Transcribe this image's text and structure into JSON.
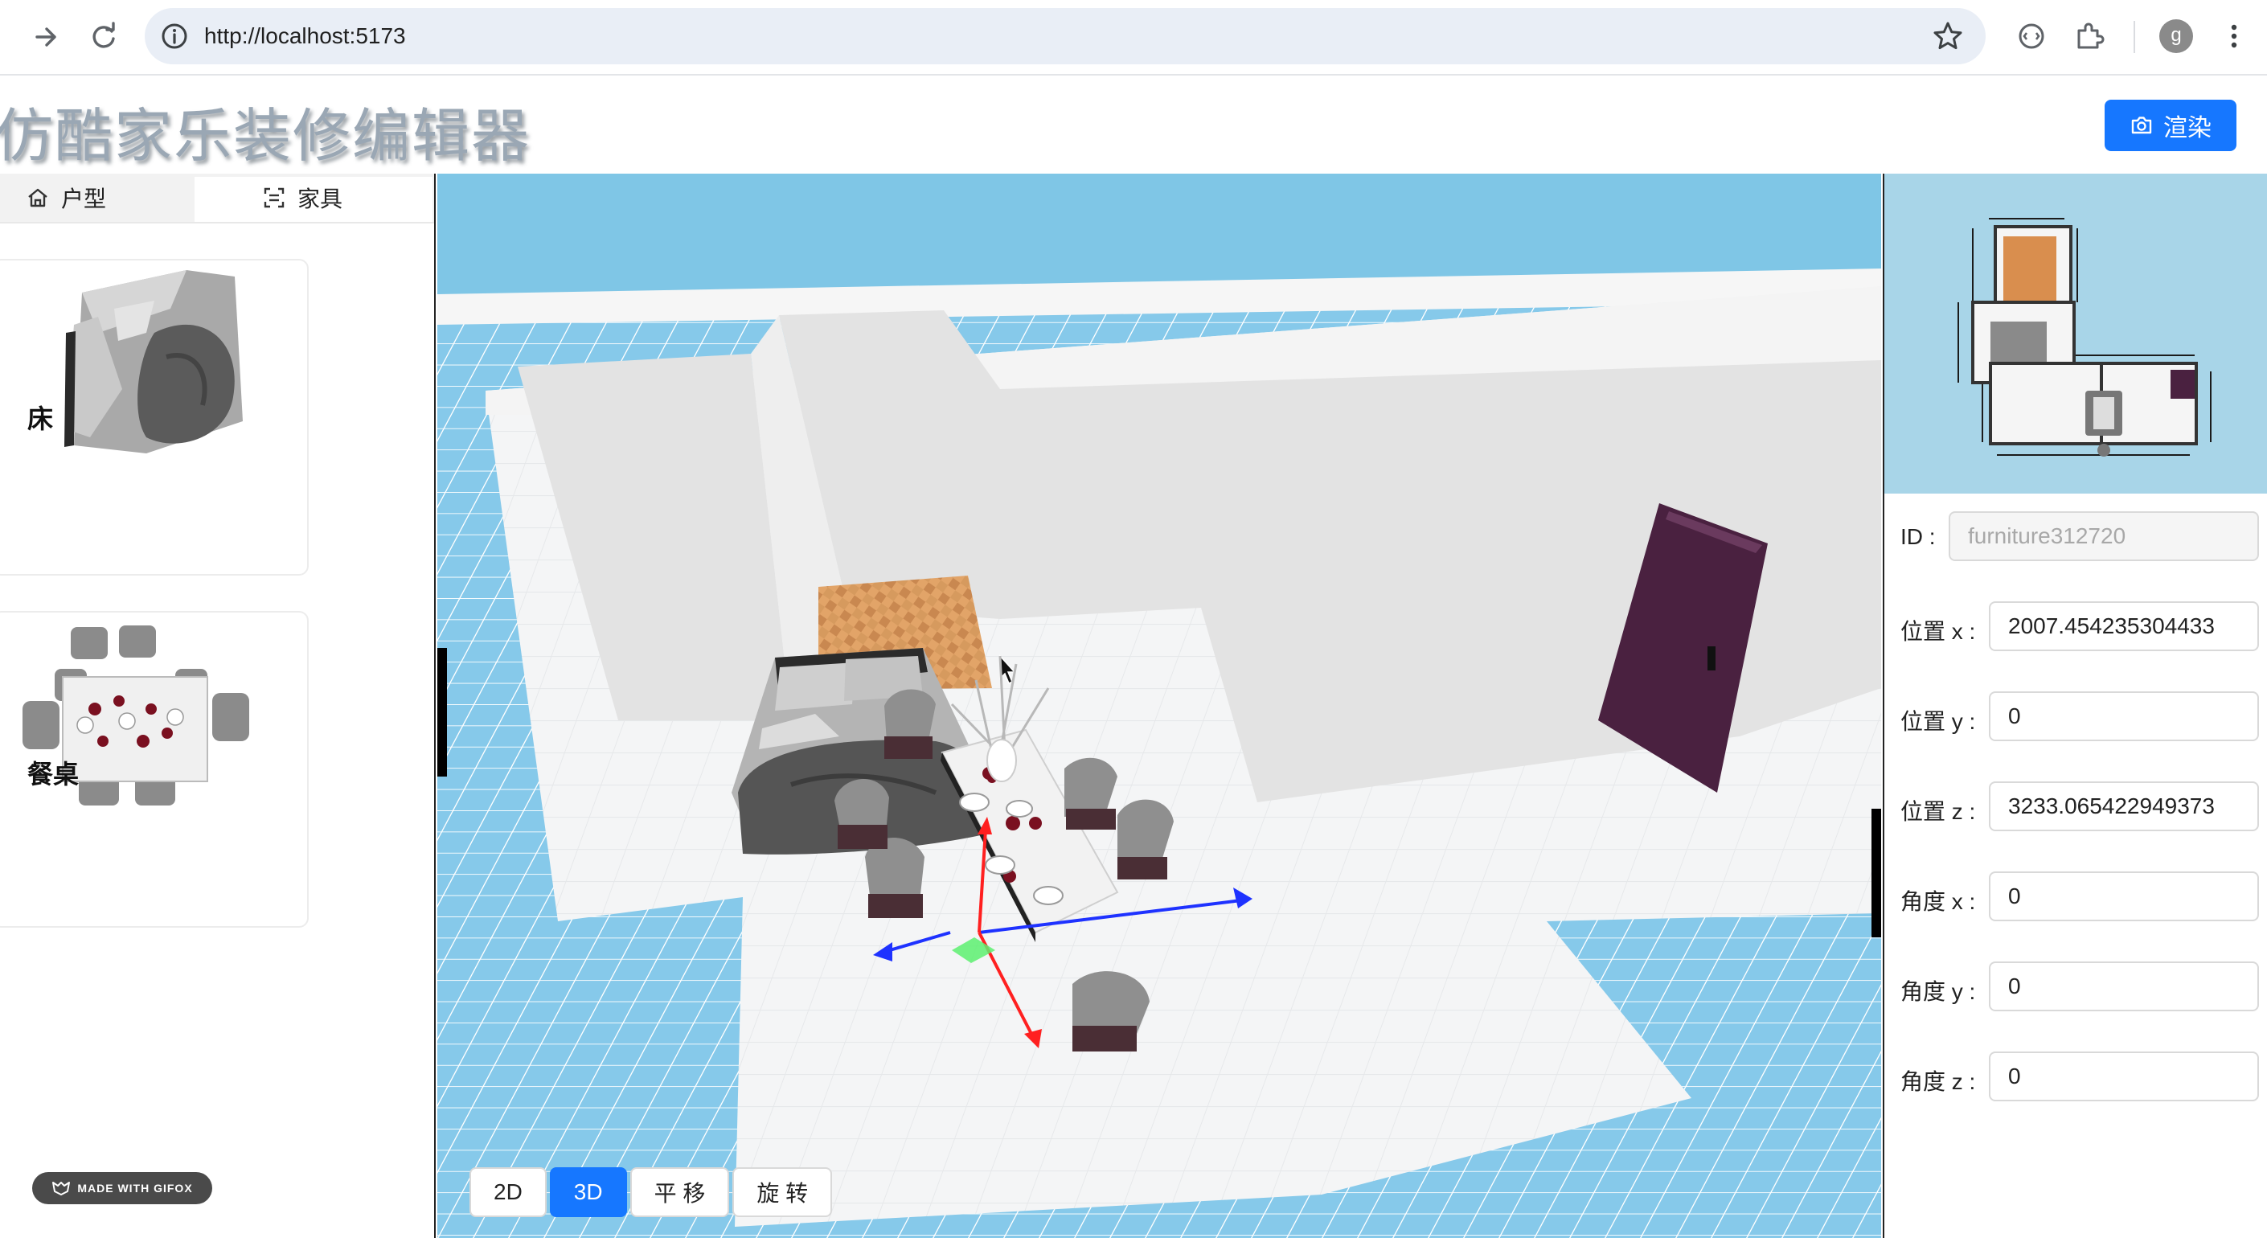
{
  "browser": {
    "url": "http://localhost:5173",
    "profile_initial": "g"
  },
  "app": {
    "title": "仿酷家乐装修编辑器",
    "render_button": "渲染"
  },
  "sidebar": {
    "tabs": [
      {
        "label": "户型",
        "icon": "home-icon",
        "active": false
      },
      {
        "label": "家具",
        "icon": "scan-icon",
        "active": true
      }
    ],
    "items": [
      {
        "label": "床"
      },
      {
        "label": "餐桌"
      }
    ]
  },
  "viewport": {
    "modes": [
      "2D",
      "3D",
      "平 移",
      "旋 转"
    ],
    "active_mode": "3D"
  },
  "properties": {
    "id": {
      "label": "ID :",
      "value": "furniture312720"
    },
    "pos_x": {
      "label": "位置 x :",
      "value": "2007.454235304433"
    },
    "pos_y": {
      "label": "位置 y :",
      "value": "0"
    },
    "pos_z": {
      "label": "位置 z :",
      "value": "3233.065422949373"
    },
    "rot_x": {
      "label": "角度 x :",
      "value": "0"
    },
    "rot_y": {
      "label": "角度 y :",
      "value": "0"
    },
    "rot_z": {
      "label": "角度 z :",
      "value": "0"
    }
  },
  "watermark": "MADE WITH GIFOX",
  "colors": {
    "accent": "#1677ff",
    "sky": "#7fc6e6",
    "floor_grid": "#8fd0ef",
    "wall": "#e2e2e2",
    "door": "#4a2140"
  }
}
